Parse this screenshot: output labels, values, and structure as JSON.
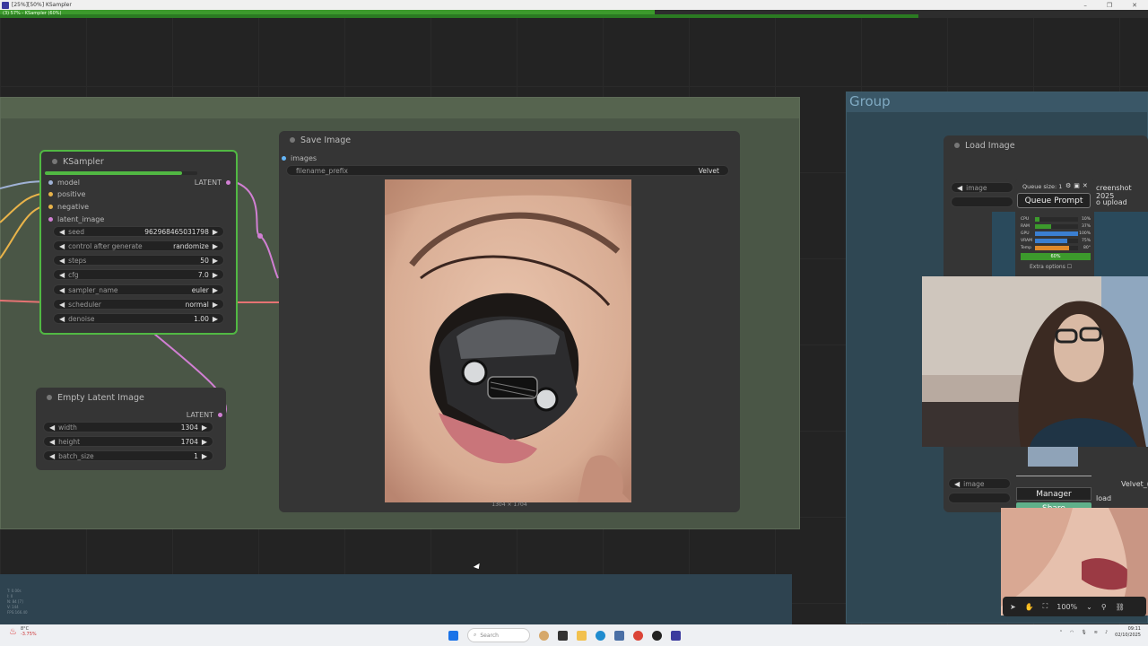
{
  "window": {
    "title": "[25%][50%] KSampler",
    "progress_text": "(3) 57% - KSampler (60%)",
    "progress_top": 0.57,
    "progress_bottom": 0.8
  },
  "groups": {
    "right_title": "Group"
  },
  "ksampler": {
    "title": "KSampler",
    "inputs": [
      "model",
      "positive",
      "negative",
      "latent_image"
    ],
    "output": "LATENT",
    "widgets": [
      {
        "label": "seed",
        "value": "962968465031798"
      },
      {
        "label": "control after generate",
        "value": "randomize"
      },
      {
        "label": "steps",
        "value": "50"
      },
      {
        "label": "cfg",
        "value": "7.0"
      },
      {
        "label": "sampler_name",
        "value": "euler"
      },
      {
        "label": "scheduler",
        "value": "normal"
      },
      {
        "label": "denoise",
        "value": "1.00"
      }
    ],
    "progress": 0.9
  },
  "empty_latent": {
    "title": "Empty Latent Image",
    "output": "LATENT",
    "widgets": [
      {
        "label": "width",
        "value": "1304"
      },
      {
        "label": "height",
        "value": "1704"
      },
      {
        "label": "batch_size",
        "value": "1"
      }
    ]
  },
  "save_image": {
    "title": "Save Image",
    "input": "images",
    "prefix_label": "filename_prefix",
    "prefix_value": "Velvet",
    "caption": "1304 × 1704"
  },
  "load_image": {
    "title": "Load Image",
    "image_label": "image",
    "image_value": "creenshot 2025",
    "upload_label": "o upload",
    "image_label_2": "image",
    "image_value_2": "Velvet_(",
    "upload_label_2": "load"
  },
  "queue": {
    "size_label": "Queue size: 1",
    "button": "Queue Prompt",
    "stats": [
      {
        "name": "CPU",
        "value": "10%"
      },
      {
        "name": "RAM",
        "value": "37%"
      },
      {
        "name": "GPU",
        "value": "100%"
      },
      {
        "name": "VRAM",
        "value": "75%"
      },
      {
        "name": "Temp",
        "value": "80°"
      }
    ],
    "progress_text": "60%",
    "extra_options": "Extra options"
  },
  "manager": {
    "manager_label": "Manager",
    "share_label": "Share"
  },
  "canvas_toolbar": {
    "zoom": "100%"
  },
  "stats_overlay": [
    "T: 0.00s",
    "I: 0",
    "N: 84 [7]",
    "V: 144",
    "FPS:166.40"
  ],
  "taskbar": {
    "weather_temp": "8°C",
    "weather_text": "-3.75%",
    "search_placeholder": "Search",
    "time": "09:11",
    "date": "02/10/2025"
  },
  "colors": {
    "accent_green": "#51b843",
    "group_green": "#4a5646",
    "group_blue": "#2f4753",
    "share": "#5fb08a"
  }
}
